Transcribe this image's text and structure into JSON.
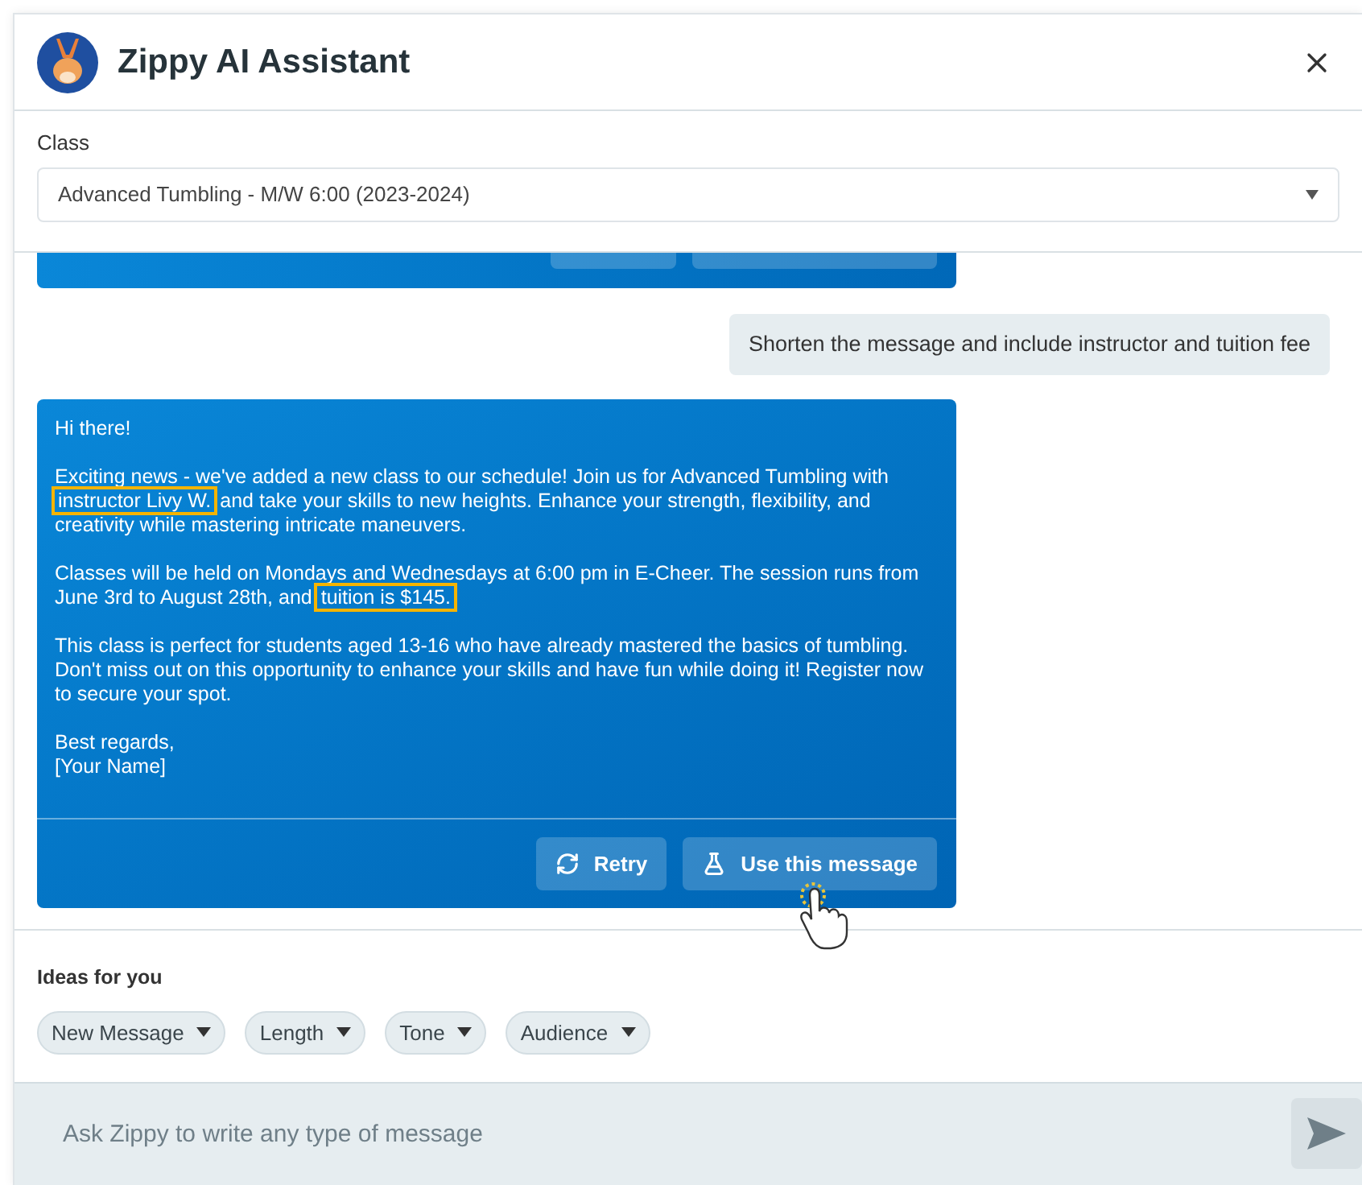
{
  "header": {
    "title": "Zippy AI Assistant"
  },
  "class_field": {
    "label": "Class",
    "value": "Advanced Tumbling - M/W 6:00 (2023-2024)"
  },
  "chat": {
    "user_message": "Shorten the message and include instructor and tuition fee",
    "reply": {
      "paragraphs": [
        {
          "segments": [
            {
              "text": "Hi there!",
              "highlighted": false
            }
          ]
        },
        {
          "segments": [
            {
              "text": "Exciting news - we've added a new class to our schedule! Join us for Advanced Tumbling with",
              "highlighted": false
            },
            {
              "text": "instructor Livy W.",
              "highlighted": true
            },
            {
              "text": "and take your skills to new heights. Enhance your strength, flexibility, and creativity while mastering intricate maneuvers.",
              "highlighted": false
            }
          ]
        },
        {
          "segments": [
            {
              "text": "Classes will be held on Mondays and Wednesdays at 6:00 pm in E-Cheer. The session runs from June 3rd to August 28th, and",
              "highlighted": false
            },
            {
              "text": "tuition is $145.",
              "highlighted": true
            }
          ]
        },
        {
          "segments": [
            {
              "text": "This class is perfect for students aged 13-16 who have already mastered the basics of tumbling. Don't miss out on this opportunity to enhance your skills and have fun while doing it! Register now to secure your spot.",
              "highlighted": false
            }
          ]
        },
        {
          "segments": [
            {
              "text": "Best regards,\n[Your Name]",
              "highlighted": false
            }
          ]
        }
      ],
      "buttons": [
        {
          "label": "Retry",
          "kind": "retry"
        },
        {
          "label": "Use this message",
          "kind": "use"
        }
      ]
    }
  },
  "ideas": {
    "title": "Ideas for you",
    "chips": [
      "New Message",
      "Length",
      "Tone",
      "Audience"
    ]
  },
  "composer": {
    "placeholder": "Ask Zippy to write any type of message"
  }
}
